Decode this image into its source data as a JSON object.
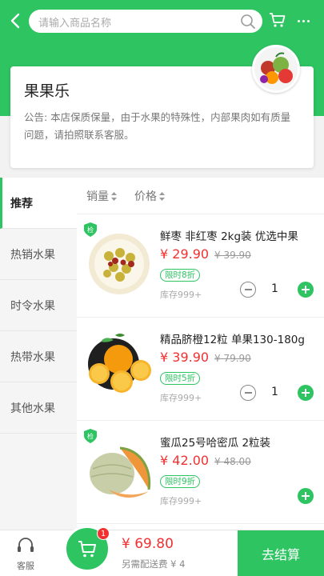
{
  "colors": {
    "brand": "#2ec462",
    "price": "#f23030"
  },
  "search": {
    "placeholder": "请输入商品名称"
  },
  "icons": {
    "back": "chevron-left-icon",
    "search": "search-icon",
    "cart": "cart-icon",
    "more": "more-icon"
  },
  "shop": {
    "name": "果果乐",
    "notice": "公告: 本店保质保量，由于水果的特殊性，内部果肉如有质量问题，请拍照联系客服。"
  },
  "sidebar": {
    "items": [
      {
        "label": "推荐",
        "active": true
      },
      {
        "label": "热销水果"
      },
      {
        "label": "时令水果"
      },
      {
        "label": "热带水果"
      },
      {
        "label": "其他水果"
      }
    ]
  },
  "sort": {
    "sales": "销量",
    "price": "价格"
  },
  "products": [
    {
      "badge": "检",
      "name": "鲜枣 非红枣 2kg装 优选中果",
      "price": "¥ 29.90",
      "orig": "¥ 39.90",
      "tag": "限时8折",
      "stock": "库存999+",
      "qty": "1"
    },
    {
      "badge": "",
      "name": "精品脐橙12粒 单果130-180g",
      "price": "¥ 39.90",
      "orig": "¥ 79.90",
      "tag": "限时5折",
      "stock": "库存999+",
      "qty": "1"
    },
    {
      "badge": "检",
      "name": "蜜瓜25号哈密瓜 2粒装",
      "price": "¥ 42.00",
      "orig": "¥ 48.00",
      "tag": "限时9折",
      "stock": "库存999+",
      "qty": ""
    }
  ],
  "bottom": {
    "service": "客服",
    "cart_count": "1",
    "total": "¥ 69.80",
    "delivery": "另需配送费 ¥ 4",
    "checkout": "去结算"
  }
}
